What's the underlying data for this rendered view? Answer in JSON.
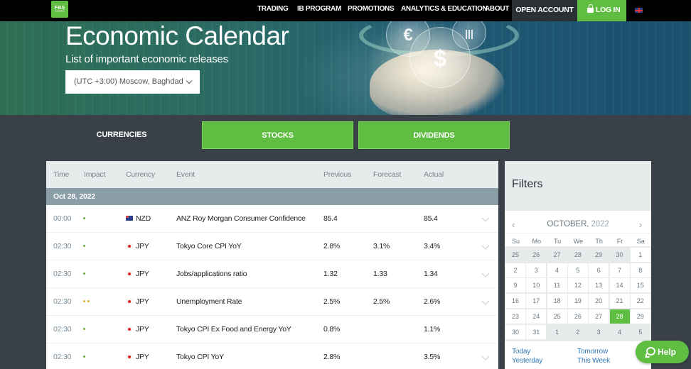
{
  "nav": {
    "logo": "FBS",
    "items": [
      "TRADING",
      "IB PROGRAM",
      "PROMOTIONS",
      "ANALYTICS & EDUCATION",
      "ABOUT"
    ],
    "open_account": "OPEN ACCOUNT",
    "login": "LOG IN",
    "language_icon": "uk-flag-icon"
  },
  "hero": {
    "title": "Economic Calendar",
    "subtitle": "List of important economic releases",
    "timezone": "(UTC +3:00) Moscow, Baghdad"
  },
  "tabs": [
    {
      "label": "CURRENCIES",
      "active": true
    },
    {
      "label": "STOCKS",
      "active": false
    },
    {
      "label": "DIVIDENDS",
      "active": false
    }
  ],
  "table": {
    "headers": {
      "time": "Time",
      "impact": "Impact",
      "currency": "Currency",
      "event": "Event",
      "previous": "Previous",
      "forecast": "Forecast",
      "actual": "Actual"
    },
    "date": "Oct 28, 2022",
    "rows": [
      {
        "time": "00:00",
        "impact": 1,
        "currency": "NZD",
        "flag": "nz",
        "event": "ANZ Roy Morgan Consumer Confidence",
        "previous": "85.4",
        "forecast": "",
        "actual": "85.4",
        "expandable": true
      },
      {
        "time": "02:30",
        "impact": 1,
        "currency": "JPY",
        "flag": "jp",
        "event": "Tokyo Core CPI YoY",
        "previous": "2.8%",
        "forecast": "3.1%",
        "actual": "3.4%",
        "expandable": true
      },
      {
        "time": "02:30",
        "impact": 1,
        "currency": "JPY",
        "flag": "jp",
        "event": "Jobs/applications ratio",
        "previous": "1.32",
        "forecast": "1.33",
        "actual": "1.34",
        "expandable": true
      },
      {
        "time": "02:30",
        "impact": 2,
        "currency": "JPY",
        "flag": "jp",
        "event": "Unemployment Rate",
        "previous": "2.5%",
        "forecast": "2.5%",
        "actual": "2.6%",
        "expandable": true
      },
      {
        "time": "02:30",
        "impact": 1,
        "currency": "JPY",
        "flag": "jp",
        "event": "Tokyo CPI Ex Food and Energy YoY",
        "previous": "0.8%",
        "forecast": "",
        "actual": "1.1%",
        "expandable": false
      },
      {
        "time": "02:30",
        "impact": 1,
        "currency": "JPY",
        "flag": "jp",
        "event": "Tokyo CPI YoY",
        "previous": "2.8%",
        "forecast": "",
        "actual": "3.5%",
        "expandable": true
      }
    ]
  },
  "filters": {
    "title": "Filters",
    "month": "OCTOBER,",
    "year": "2022",
    "weekdays": [
      "Su",
      "Mo",
      "Tu",
      "We",
      "Th",
      "Fr",
      "Sa"
    ],
    "days": [
      [
        "25",
        "26",
        "27",
        "28",
        "29",
        "30",
        "1"
      ],
      [
        "2",
        "3",
        "4",
        "5",
        "6",
        "7",
        "8"
      ],
      [
        "9",
        "10",
        "11",
        "12",
        "13",
        "14",
        "15"
      ],
      [
        "16",
        "17",
        "18",
        "19",
        "20",
        "21",
        "22"
      ],
      [
        "23",
        "24",
        "25",
        "26",
        "27",
        "28",
        "29"
      ],
      [
        "30",
        "31",
        "1",
        "2",
        "3",
        "4",
        "5"
      ]
    ],
    "selected_day": "28",
    "quick_links": [
      "Today",
      "Tomorrow",
      "Yesterday",
      "This Week"
    ]
  },
  "help": {
    "label": "Help"
  },
  "colors": {
    "accent": "#5fbe42",
    "dark": "#3a4047",
    "header_gray": "#e8ebec",
    "date_row": "#8a9ea8",
    "link": "#2f79b8",
    "impact_low": "#6aaa3a",
    "impact_medium": "#e0b020"
  }
}
